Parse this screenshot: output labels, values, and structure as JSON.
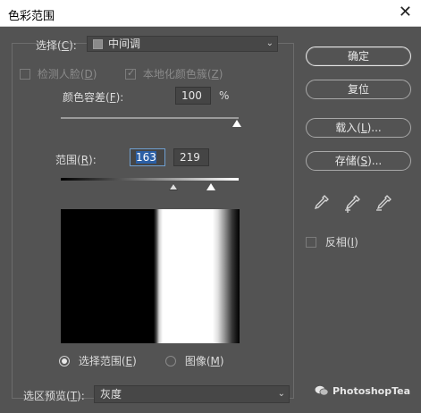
{
  "window": {
    "title": "色彩范围",
    "close_glyph": "✕"
  },
  "select": {
    "label": "选择(",
    "key": "C",
    "suffix": "):",
    "value": "中间调",
    "swatch_color": "#8a8a8a"
  },
  "detect_faces": {
    "label": "检测人脸(",
    "key": "D",
    "suffix": ")",
    "checked": false,
    "enabled": false
  },
  "localized_clusters": {
    "label": "本地化颜色簇(",
    "key": "Z",
    "suffix": ")",
    "checked": true,
    "enabled": false
  },
  "fuzziness": {
    "label": "颜色容差(",
    "key": "F",
    "suffix": "):",
    "value": "100",
    "unit": "%"
  },
  "range": {
    "label": "范围(",
    "key": "R",
    "suffix": "):",
    "value_low": "163",
    "value_high": "219"
  },
  "view": {
    "option_selection": {
      "label": "选择范围(",
      "key": "E",
      "suffix": ")",
      "selected": true
    },
    "option_image": {
      "label": "图像(",
      "key": "M",
      "suffix": ")",
      "selected": false
    }
  },
  "selection_preview": {
    "label": "选区预览(",
    "key": "T",
    "suffix": "):",
    "value": "灰度"
  },
  "buttons": {
    "ok": "确定",
    "reset": "复位",
    "load_label": "载入(",
    "load_key": "L",
    "load_suffix": ")...",
    "save_label": "存储(",
    "save_key": "S",
    "save_suffix": ")..."
  },
  "invert": {
    "label": "反相(",
    "key": "I",
    "suffix": ")",
    "checked": false
  },
  "eyedroppers": [
    "eyedropper-icon",
    "eyedropper-plus-icon",
    "eyedropper-minus-icon"
  ],
  "watermark": {
    "text": "PhotoshopTea"
  }
}
